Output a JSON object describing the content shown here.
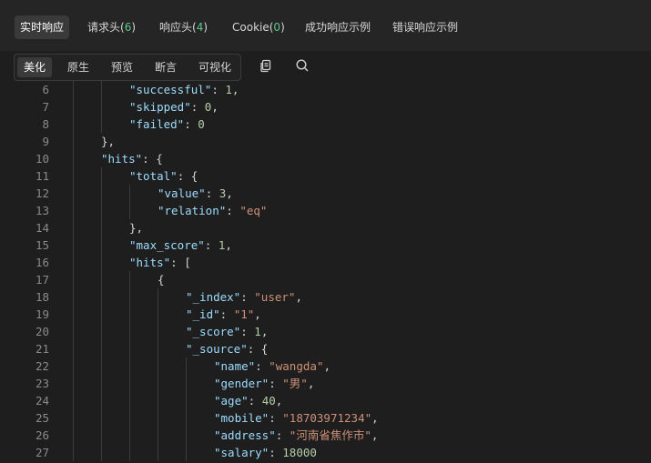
{
  "tabs": [
    {
      "label": "实时响应",
      "active": true
    },
    {
      "label": "请求头",
      "count": "6"
    },
    {
      "label": "响应头",
      "count": "4"
    },
    {
      "label": "Cookie",
      "count": "0"
    },
    {
      "label": "成功响应示例"
    },
    {
      "label": "错误响应示例"
    }
  ],
  "view_modes": [
    {
      "label": "美化",
      "active": true
    },
    {
      "label": "原生"
    },
    {
      "label": "预览"
    },
    {
      "label": "断言"
    },
    {
      "label": "可视化"
    }
  ],
  "toolbar_icons": [
    "copy-icon",
    "search-icon"
  ],
  "colors": {
    "key": "#9cdcfe",
    "string": "#ce9178",
    "number": "#b5cea8",
    "count": "#5cc98a"
  },
  "code_lines": [
    {
      "n": "6",
      "indent": 2,
      "parts": [
        {
          "t": "k",
          "v": "\"successful\""
        },
        {
          "t": "p",
          "v": ": "
        },
        {
          "t": "n",
          "v": "1"
        },
        {
          "t": "p",
          "v": ","
        }
      ]
    },
    {
      "n": "7",
      "indent": 2,
      "parts": [
        {
          "t": "k",
          "v": "\"skipped\""
        },
        {
          "t": "p",
          "v": ": "
        },
        {
          "t": "n",
          "v": "0"
        },
        {
          "t": "p",
          "v": ","
        }
      ]
    },
    {
      "n": "8",
      "indent": 2,
      "parts": [
        {
          "t": "k",
          "v": "\"failed\""
        },
        {
          "t": "p",
          "v": ": "
        },
        {
          "t": "n",
          "v": "0"
        }
      ]
    },
    {
      "n": "9",
      "indent": 1,
      "parts": [
        {
          "t": "p",
          "v": "},"
        }
      ]
    },
    {
      "n": "10",
      "indent": 1,
      "parts": [
        {
          "t": "k",
          "v": "\"hits\""
        },
        {
          "t": "p",
          "v": ": {"
        }
      ]
    },
    {
      "n": "11",
      "indent": 2,
      "parts": [
        {
          "t": "k",
          "v": "\"total\""
        },
        {
          "t": "p",
          "v": ": {"
        }
      ]
    },
    {
      "n": "12",
      "indent": 3,
      "parts": [
        {
          "t": "k",
          "v": "\"value\""
        },
        {
          "t": "p",
          "v": ": "
        },
        {
          "t": "n",
          "v": "3"
        },
        {
          "t": "p",
          "v": ","
        }
      ]
    },
    {
      "n": "13",
      "indent": 3,
      "parts": [
        {
          "t": "k",
          "v": "\"relation\""
        },
        {
          "t": "p",
          "v": ": "
        },
        {
          "t": "s",
          "v": "\"eq\""
        }
      ]
    },
    {
      "n": "14",
      "indent": 2,
      "parts": [
        {
          "t": "p",
          "v": "},"
        }
      ]
    },
    {
      "n": "15",
      "indent": 2,
      "parts": [
        {
          "t": "k",
          "v": "\"max_score\""
        },
        {
          "t": "p",
          "v": ": "
        },
        {
          "t": "n",
          "v": "1"
        },
        {
          "t": "p",
          "v": ","
        }
      ]
    },
    {
      "n": "16",
      "indent": 2,
      "parts": [
        {
          "t": "k",
          "v": "\"hits\""
        },
        {
          "t": "p",
          "v": ": ["
        }
      ]
    },
    {
      "n": "17",
      "indent": 3,
      "parts": [
        {
          "t": "p",
          "v": "{"
        }
      ]
    },
    {
      "n": "18",
      "indent": 4,
      "parts": [
        {
          "t": "k",
          "v": "\"_index\""
        },
        {
          "t": "p",
          "v": ": "
        },
        {
          "t": "s",
          "v": "\"user\""
        },
        {
          "t": "p",
          "v": ","
        }
      ]
    },
    {
      "n": "19",
      "indent": 4,
      "parts": [
        {
          "t": "k",
          "v": "\"_id\""
        },
        {
          "t": "p",
          "v": ": "
        },
        {
          "t": "s",
          "v": "\"1\""
        },
        {
          "t": "p",
          "v": ","
        }
      ]
    },
    {
      "n": "20",
      "indent": 4,
      "parts": [
        {
          "t": "k",
          "v": "\"_score\""
        },
        {
          "t": "p",
          "v": ": "
        },
        {
          "t": "n",
          "v": "1"
        },
        {
          "t": "p",
          "v": ","
        }
      ]
    },
    {
      "n": "21",
      "indent": 4,
      "parts": [
        {
          "t": "k",
          "v": "\"_source\""
        },
        {
          "t": "p",
          "v": ": {"
        }
      ]
    },
    {
      "n": "22",
      "indent": 5,
      "parts": [
        {
          "t": "k",
          "v": "\"name\""
        },
        {
          "t": "p",
          "v": ": "
        },
        {
          "t": "s",
          "v": "\"wangda\""
        },
        {
          "t": "p",
          "v": ","
        }
      ]
    },
    {
      "n": "23",
      "indent": 5,
      "parts": [
        {
          "t": "k",
          "v": "\"gender\""
        },
        {
          "t": "p",
          "v": ": "
        },
        {
          "t": "s",
          "v": "\"男\""
        },
        {
          "t": "p",
          "v": ","
        }
      ]
    },
    {
      "n": "24",
      "indent": 5,
      "parts": [
        {
          "t": "k",
          "v": "\"age\""
        },
        {
          "t": "p",
          "v": ": "
        },
        {
          "t": "n",
          "v": "40"
        },
        {
          "t": "p",
          "v": ","
        }
      ]
    },
    {
      "n": "25",
      "indent": 5,
      "parts": [
        {
          "t": "k",
          "v": "\"mobile\""
        },
        {
          "t": "p",
          "v": ": "
        },
        {
          "t": "s",
          "v": "\"18703971234\""
        },
        {
          "t": "p",
          "v": ","
        }
      ]
    },
    {
      "n": "26",
      "indent": 5,
      "parts": [
        {
          "t": "k",
          "v": "\"address\""
        },
        {
          "t": "p",
          "v": ": "
        },
        {
          "t": "s",
          "v": "\"河南省焦作市\""
        },
        {
          "t": "p",
          "v": ","
        }
      ]
    },
    {
      "n": "27",
      "indent": 5,
      "parts": [
        {
          "t": "k",
          "v": "\"salary\""
        },
        {
          "t": "p",
          "v": ": "
        },
        {
          "t": "n",
          "v": "18000"
        }
      ]
    }
  ]
}
